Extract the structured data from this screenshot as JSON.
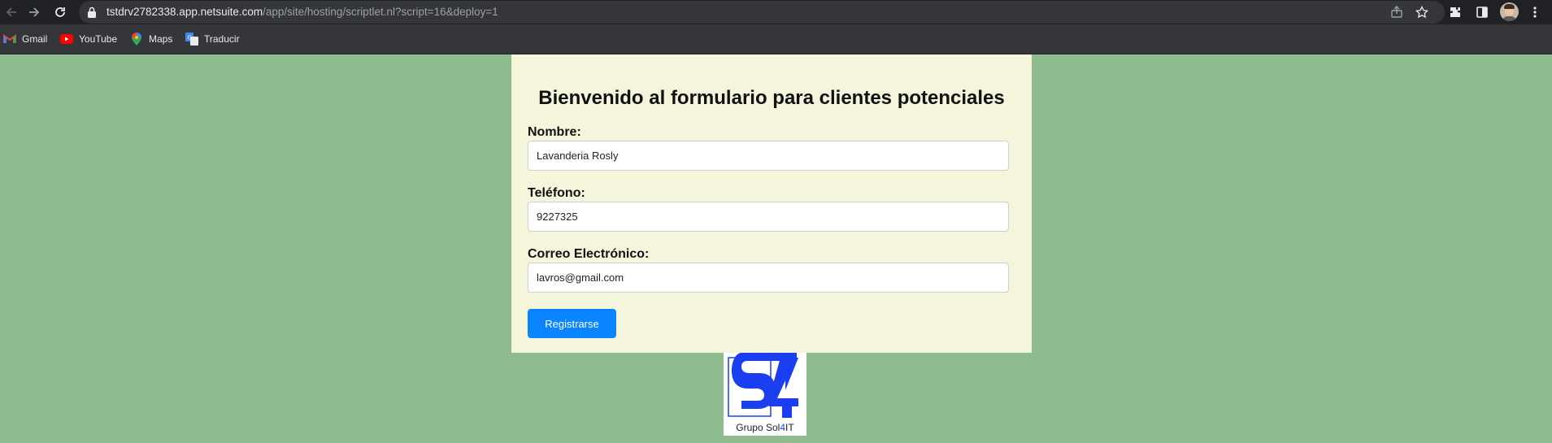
{
  "browser": {
    "url_domain": "tstdrv2782338.app.netsuite.com",
    "url_path": "/app/site/hosting/scriptlet.nl?script=16&deploy=1",
    "icons": [
      "back-icon",
      "forward-icon",
      "reload-icon",
      "lock-icon",
      "share-icon",
      "star-icon",
      "extensions-icon",
      "side-panel-icon",
      "profile-avatar",
      "menu-icon"
    ]
  },
  "bookmarks": [
    {
      "label": "Gmail",
      "icon": "gmail-icon"
    },
    {
      "label": "YouTube",
      "icon": "youtube-icon"
    },
    {
      "label": "Maps",
      "icon": "maps-icon"
    },
    {
      "label": "Traducir",
      "icon": "translate-icon"
    }
  ],
  "form": {
    "title": "Bienvenido al formulario para clientes potenciales",
    "name_label": "Nombre:",
    "name_value": "Lavanderia Rosly",
    "phone_label": "Teléfono:",
    "phone_value": "9227325",
    "email_label": "Correo Electrónico:",
    "email_value": "lavros@gmail.com",
    "submit_label": "Registrarse"
  },
  "logo": {
    "text_prefix": "Grupo Sol",
    "text_highlight": "4",
    "text_suffix": "IT"
  },
  "colors": {
    "page_background": "#8fbc8f",
    "card_background": "#f5f5dc",
    "button": "#0a84ff",
    "logo_blue": "#1a3ef0"
  }
}
